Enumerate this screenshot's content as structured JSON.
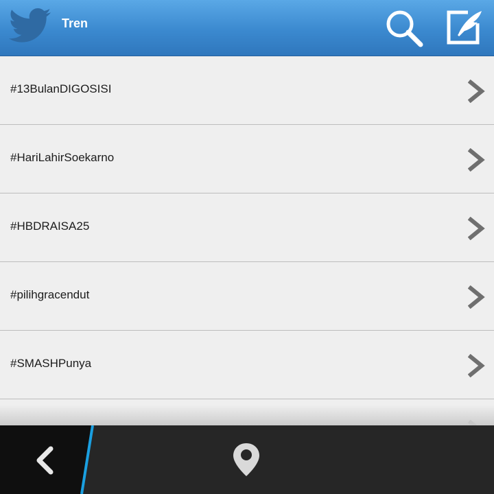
{
  "header": {
    "title": "Tren",
    "logo_icon": "twitter-bird-icon",
    "search_icon": "search-icon",
    "compose_icon": "compose-icon",
    "colors": {
      "bar_top": "#5aa8e6",
      "bar_bottom": "#2f77bd"
    }
  },
  "trends": [
    {
      "label": "#13BulanDIGOSISI"
    },
    {
      "label": "#HariLahirSoekarno"
    },
    {
      "label": "#HBDRAISA25"
    },
    {
      "label": "#pilihgracendut"
    },
    {
      "label": "#SMASHPunya"
    }
  ],
  "bottombar": {
    "back_icon": "back-chevron-icon",
    "location_icon": "location-pin-icon",
    "accent": "#1a9fe0"
  }
}
